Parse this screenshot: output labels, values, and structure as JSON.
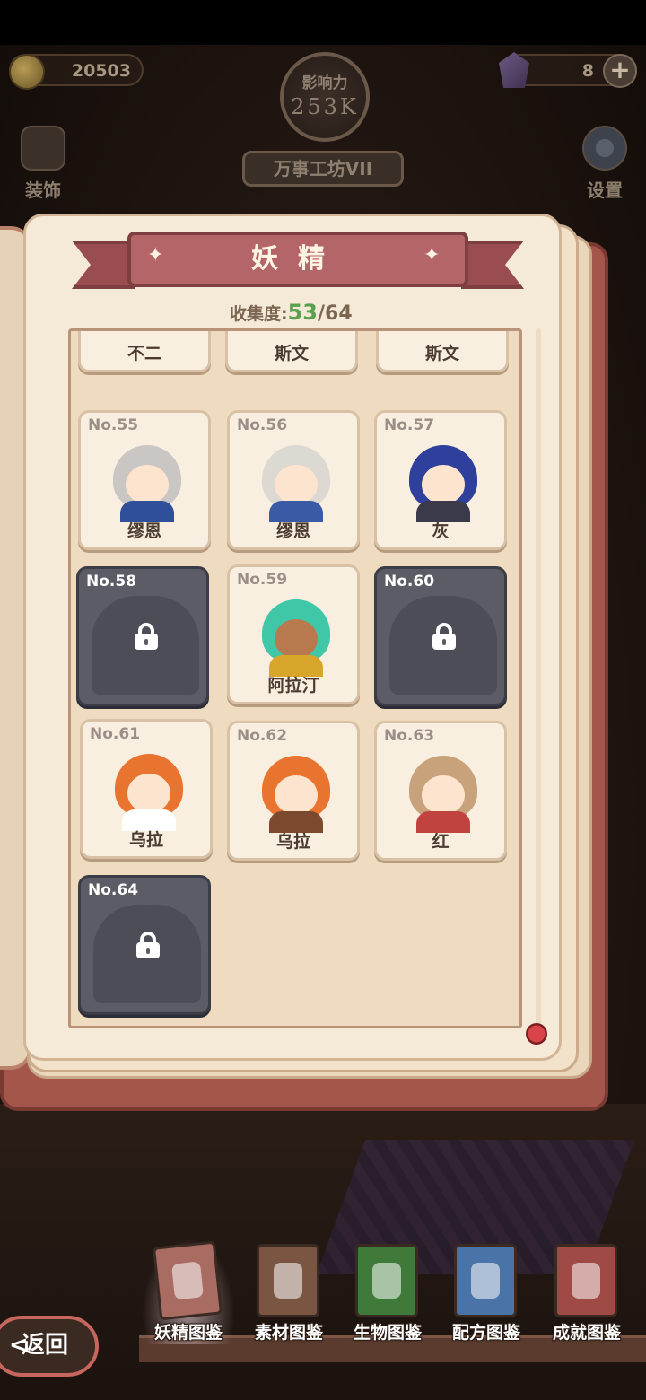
{
  "hud": {
    "coins": "20503",
    "gems": "8",
    "plus_symbol": "+",
    "influence_label": "影响力",
    "influence_value": "253K",
    "workshop_name": "万事工坊VII",
    "decor_label": "装饰",
    "settings_label": "设置"
  },
  "book": {
    "title": "妖精",
    "collection_label": "收集度:",
    "collected": "53",
    "total": "/64",
    "top_row_names": [
      "不二",
      "斯文",
      "斯文"
    ],
    "cards": [
      {
        "no": "No.55",
        "name": "缪恩",
        "locked": false
      },
      {
        "no": "No.56",
        "name": "缪恩",
        "locked": false
      },
      {
        "no": "No.57",
        "name": "灰",
        "locked": false
      },
      {
        "no": "No.58",
        "name": "",
        "locked": true
      },
      {
        "no": "No.59",
        "name": "阿拉汀",
        "locked": false
      },
      {
        "no": "No.60",
        "name": "",
        "locked": true
      },
      {
        "no": "No.61",
        "name": "乌拉",
        "locked": false
      },
      {
        "no": "No.62",
        "name": "乌拉",
        "locked": false
      },
      {
        "no": "No.63",
        "name": "红",
        "locked": false
      },
      {
        "no": "No.64",
        "name": "",
        "locked": true
      }
    ]
  },
  "nav": {
    "back_label": "返回",
    "back_arrow": "<",
    "tabs": [
      "妖精图鉴",
      "素材图鉴",
      "生物图鉴",
      "配方图鉴",
      "成就图鉴"
    ],
    "active_tab": "妖精图鉴"
  },
  "colors": {
    "banner": "#b46568",
    "collected_count": "#5aa04f",
    "locked_card": "#5c5c67"
  }
}
